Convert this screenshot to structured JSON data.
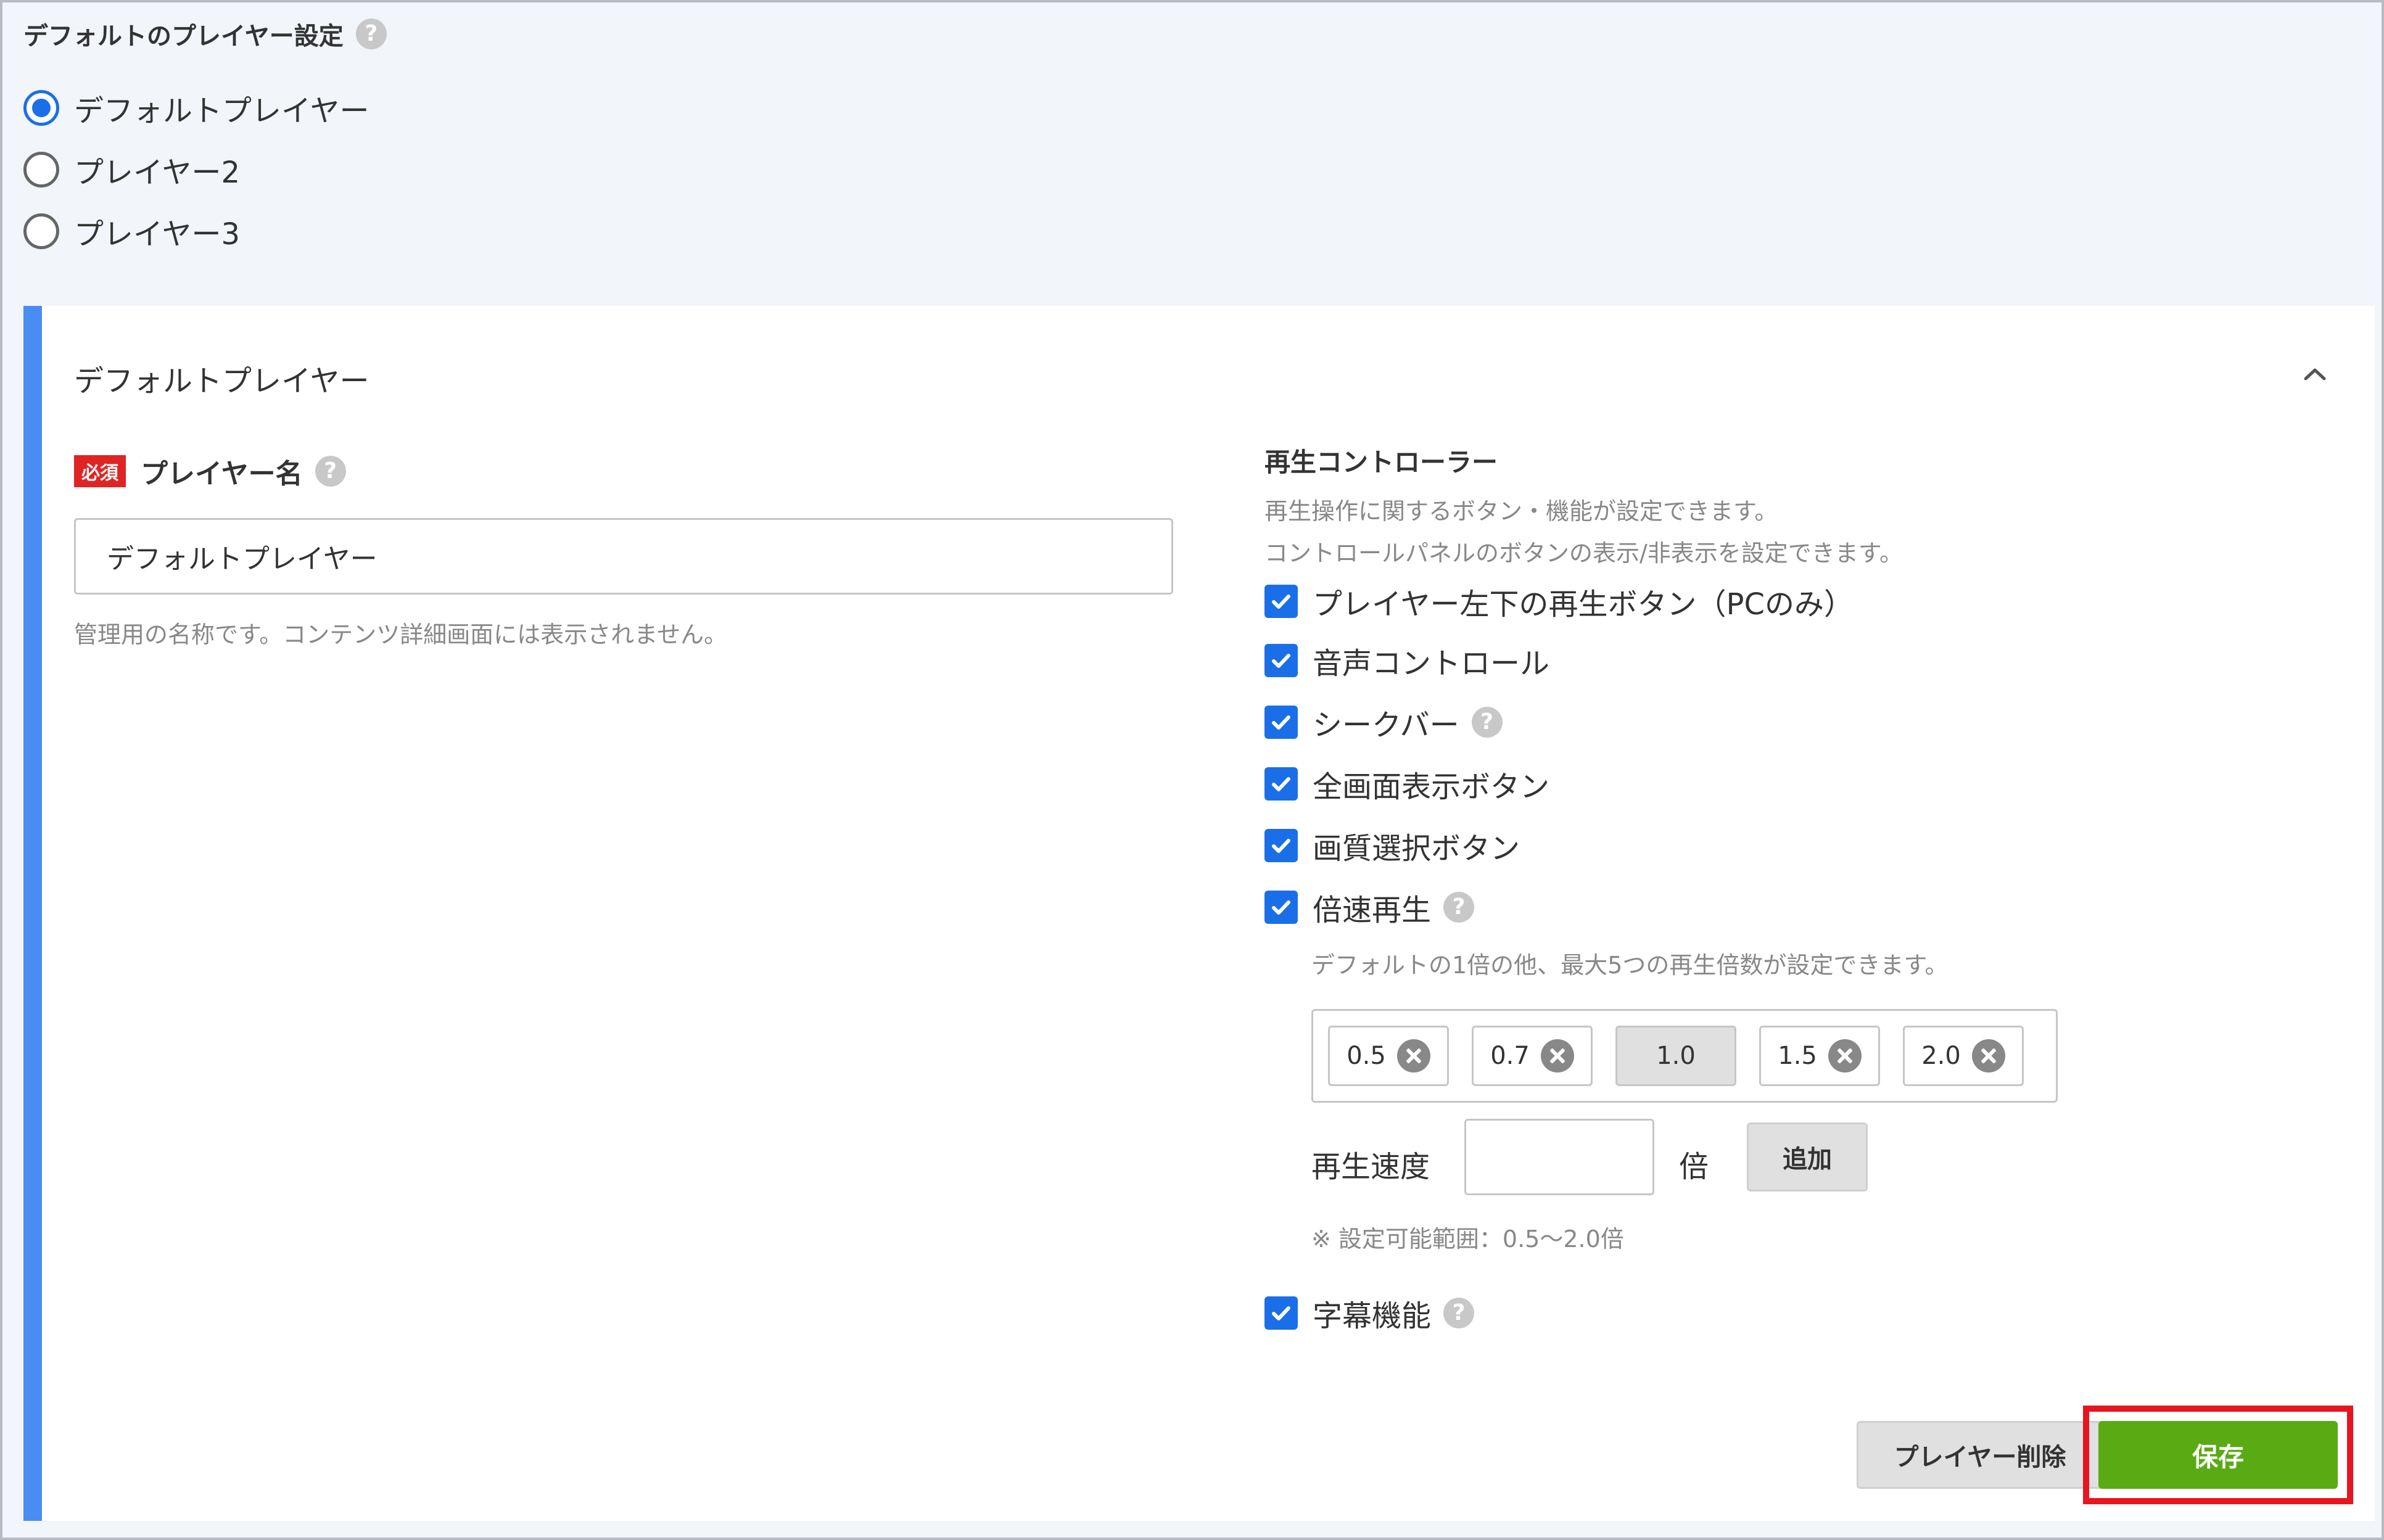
{
  "header": {
    "title": "デフォルトのプレイヤー設定",
    "help_glyph": "?"
  },
  "player_options": [
    {
      "label": "デフォルトプレイヤー",
      "selected": true
    },
    {
      "label": "プレイヤー2",
      "selected": false
    },
    {
      "label": "プレイヤー3",
      "selected": false
    }
  ],
  "panel": {
    "title": "デフォルトプレイヤー",
    "accent_color": "#4a8df2",
    "player_name": {
      "required_badge": "必須",
      "label": "プレイヤー名",
      "value": "デフォルトプレイヤー",
      "hint": "管理用の名称です。コンテンツ詳細画面には表示されません。"
    },
    "controller": {
      "title": "再生コントローラー",
      "desc_line1": "再生操作に関するボタン・機能が設定できます。",
      "desc_line2": "コントロールパネルのボタンの表示/非表示を設定できます。",
      "options": [
        {
          "label": "プレイヤー左下の再生ボタン（PCのみ）",
          "checked": true
        },
        {
          "label": "音声コントロール",
          "checked": true
        },
        {
          "label": "シークバー",
          "checked": true
        },
        {
          "label": "全画面表示ボタン",
          "checked": true
        },
        {
          "label": "画質選択ボタン",
          "checked": true
        },
        {
          "label": "倍速再生",
          "checked": true
        },
        {
          "label": "字幕機能",
          "checked": true
        }
      ],
      "speed_hint": "デフォルトの1倍の他、最大5つの再生倍数が設定できます。",
      "speeds": [
        "0.5",
        "0.7",
        "1.0",
        "1.5",
        "2.0"
      ],
      "speed_input_label": "再生速度",
      "speed_input_value": "",
      "speed_unit": "倍",
      "add_button": "追加",
      "range_note": "※ 設定可能範囲：0.5〜2.0倍"
    }
  },
  "footer": {
    "delete_button": "プレイヤー削除",
    "save_button": "保存",
    "save_color": "#5aaa14",
    "highlight_color": "#e8141e"
  }
}
